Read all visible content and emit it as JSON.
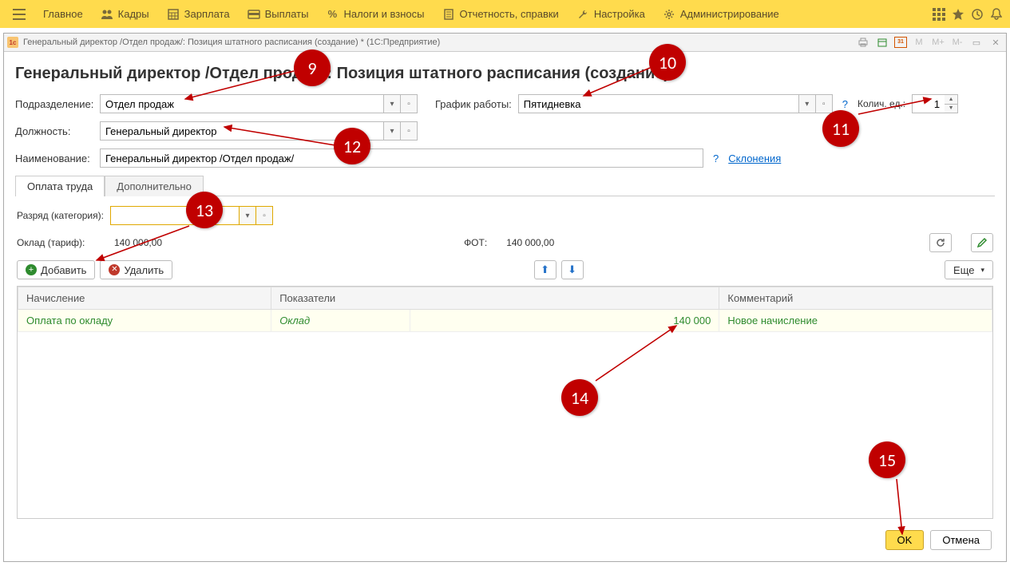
{
  "topmenu": {
    "main": "Главное",
    "hr": "Кадры",
    "salary": "Зарплата",
    "payments": "Выплаты",
    "taxes": "Налоги и взносы",
    "reports": "Отчетность, справки",
    "settings": "Настройка",
    "admin": "Администрирование"
  },
  "window": {
    "title": "Генеральный директор /Отдел продаж/: Позиция штатного расписания (создание) *  (1С:Предприятие)",
    "tb_m": "M",
    "tb_mp": "M+",
    "tb_mm": "M-"
  },
  "header": "Генеральный директор /Отдел продаж/: Позиция штатного расписания (создание) *",
  "labels": {
    "dept": "Подразделение:",
    "sched": "График работы:",
    "qty": "Колич. ед.:",
    "pos": "Должность:",
    "name": "Наименование:",
    "decl": "Склонения",
    "rank": "Разряд (категория):",
    "oklad": "Оклад (тариф):",
    "fot": "ФОТ:"
  },
  "values": {
    "dept": "Отдел продаж",
    "sched": "Пятидневка",
    "qty": "1",
    "pos": "Генеральный директор",
    "name": "Генеральный директор /Отдел продаж/",
    "rank": "",
    "oklad": "140 000,00",
    "fot": "140 000,00"
  },
  "tabs": {
    "pay": "Оплата труда",
    "extra": "Дополнительно"
  },
  "buttons": {
    "add": "Добавить",
    "del": "Удалить",
    "more": "Еще",
    "ok": "OK",
    "cancel": "Отмена"
  },
  "table": {
    "h1": "Начисление",
    "h2": "Показатели",
    "h3": "Комментарий",
    "r1c1": "Оплата по окладу",
    "r1c2": "Оклад",
    "r1c2v": "140 000",
    "r1c3": "Новое начисление"
  },
  "callouts": {
    "c9": "9",
    "c10": "10",
    "c11": "11",
    "c12": "12",
    "c13": "13",
    "c14": "14",
    "c15": "15"
  }
}
